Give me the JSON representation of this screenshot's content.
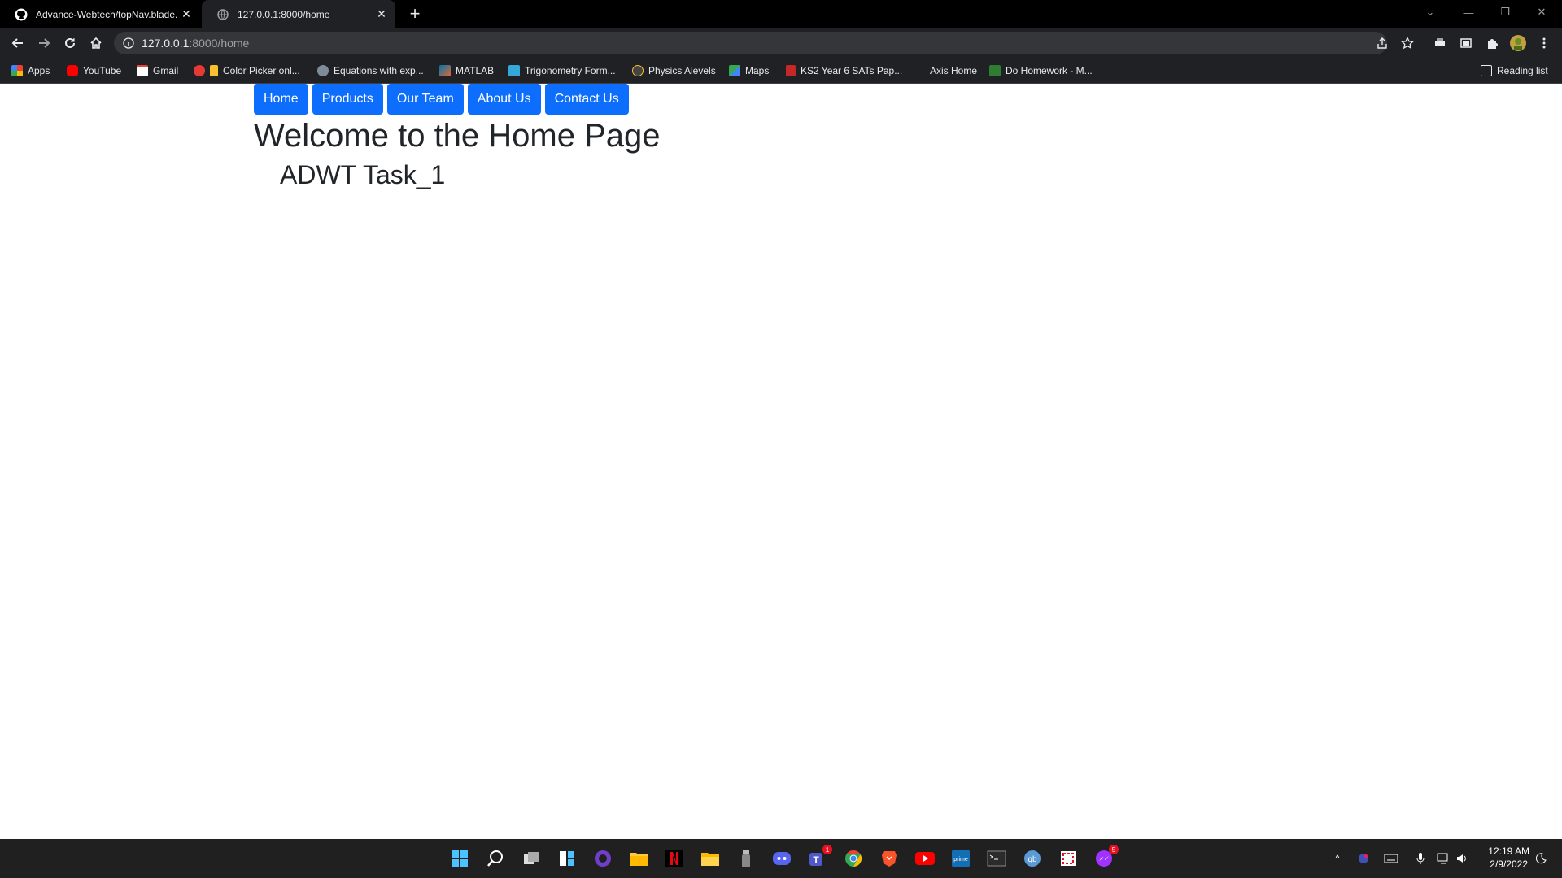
{
  "browser": {
    "tabs": [
      {
        "title": "Advance-Webtech/topNav.blade.",
        "active": false
      },
      {
        "title": "127.0.0.1:8000/home",
        "active": true
      }
    ],
    "address": {
      "host": "127.0.0.1",
      "rest": ":8000/home"
    },
    "bookmarks": [
      {
        "label": "Apps",
        "icon": "apps-grid-icon",
        "color": "#ea4335"
      },
      {
        "label": "YouTube",
        "icon": "youtube-icon",
        "color": "#ff0000"
      },
      {
        "label": "Gmail",
        "icon": "gmail-icon",
        "color": "#ea4335"
      },
      {
        "label": "Color Picker onl...",
        "icon": "color-picker-icon",
        "color": "#e53935"
      },
      {
        "label": "Equations with exp...",
        "icon": "equations-icon",
        "color": "#7e8c9a"
      },
      {
        "label": "MATLAB",
        "icon": "matlab-icon",
        "color": "#e16737"
      },
      {
        "label": "Trigonometry Form...",
        "icon": "trig-icon",
        "color": "#35a7d8"
      },
      {
        "label": "Physics Alevels",
        "icon": "physics-icon",
        "color": "#444444"
      },
      {
        "label": "Maps",
        "icon": "maps-icon",
        "color": "#34a853"
      },
      {
        "label": "KS2 Year 6 SATs Pap...",
        "icon": "bookmark-flag-icon",
        "color": "#c62828"
      },
      {
        "label": "Axis Home",
        "icon": "",
        "color": "#202124"
      },
      {
        "label": "Do Homework - M...",
        "icon": "homework-icon",
        "color": "#2e7d32"
      }
    ],
    "reading_list": "Reading list"
  },
  "page": {
    "nav": [
      "Home",
      "Products",
      "Our Team",
      "About Us",
      "Contact Us"
    ],
    "heading": "Welcome to the Home Page",
    "subheading": "ADWT Task_1",
    "accent": "#0d6efd"
  },
  "taskbar": {
    "time": "12:19 AM",
    "date": "2/9/2022",
    "badges": {
      "teams": "1",
      "messenger": "5"
    }
  }
}
